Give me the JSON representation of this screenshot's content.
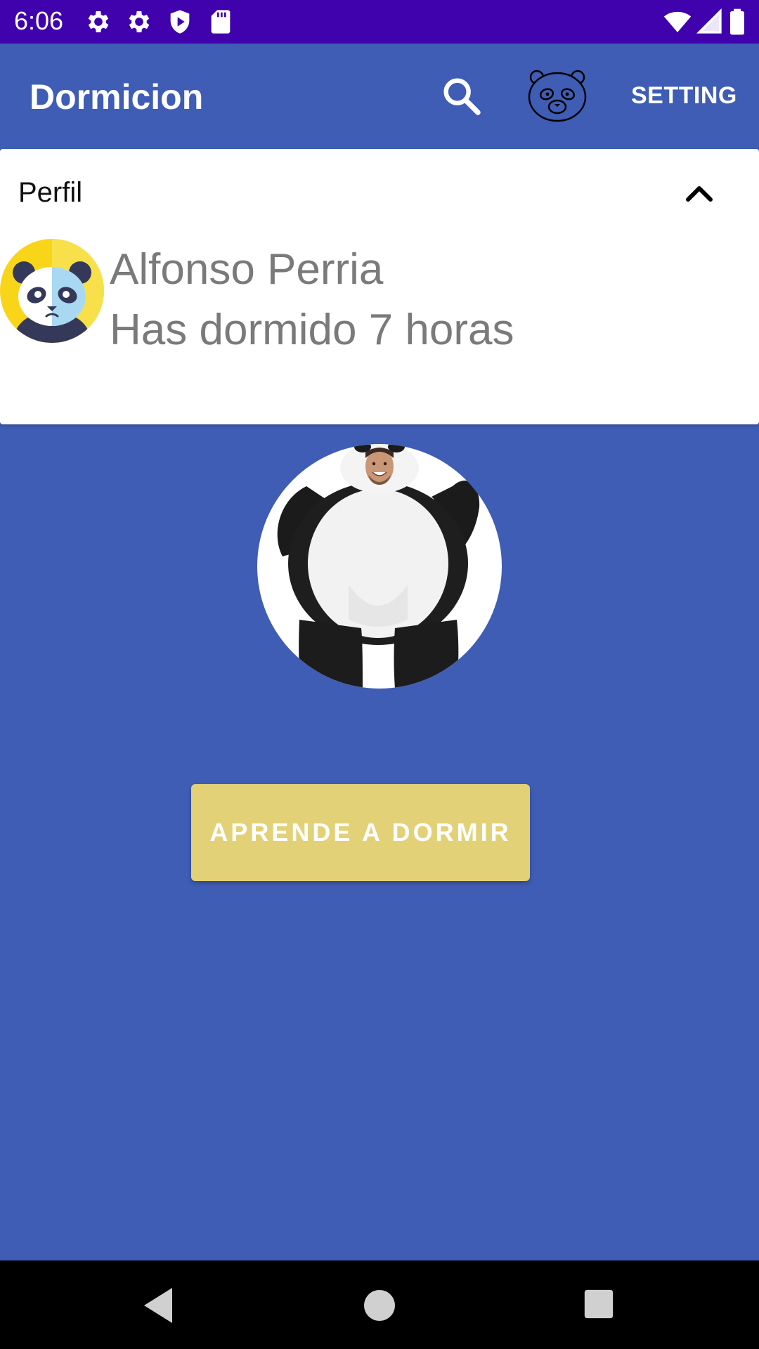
{
  "status_bar": {
    "time": "6:06",
    "icons": [
      "settings-icon",
      "settings-icon",
      "shield-play-icon",
      "sd-card-icon",
      "wifi-icon",
      "signal-icon",
      "battery-icon"
    ]
  },
  "app_bar": {
    "title": "Dormicion",
    "search_icon": "search-icon",
    "panda_icon": "panda-face-icon",
    "setting_label": "SETTING"
  },
  "profile_card": {
    "title": "Perfil",
    "collapse_icon": "chevron-up-icon",
    "user_name": "Alfonso Perria",
    "sleep_text": "Has dormido 7 horas"
  },
  "main": {
    "photo_description_icon": "panda-costume-photo",
    "learn_button_label": "APRENDE A DORMIR"
  },
  "colors": {
    "status_bar": "#3f02ac",
    "primary": "#3f5db4",
    "button": "#e3d178",
    "card": "#ffffff",
    "muted_text": "#7a7a7a"
  },
  "nav_bar": {
    "icons": [
      "back-icon",
      "home-icon",
      "recents-icon"
    ]
  }
}
